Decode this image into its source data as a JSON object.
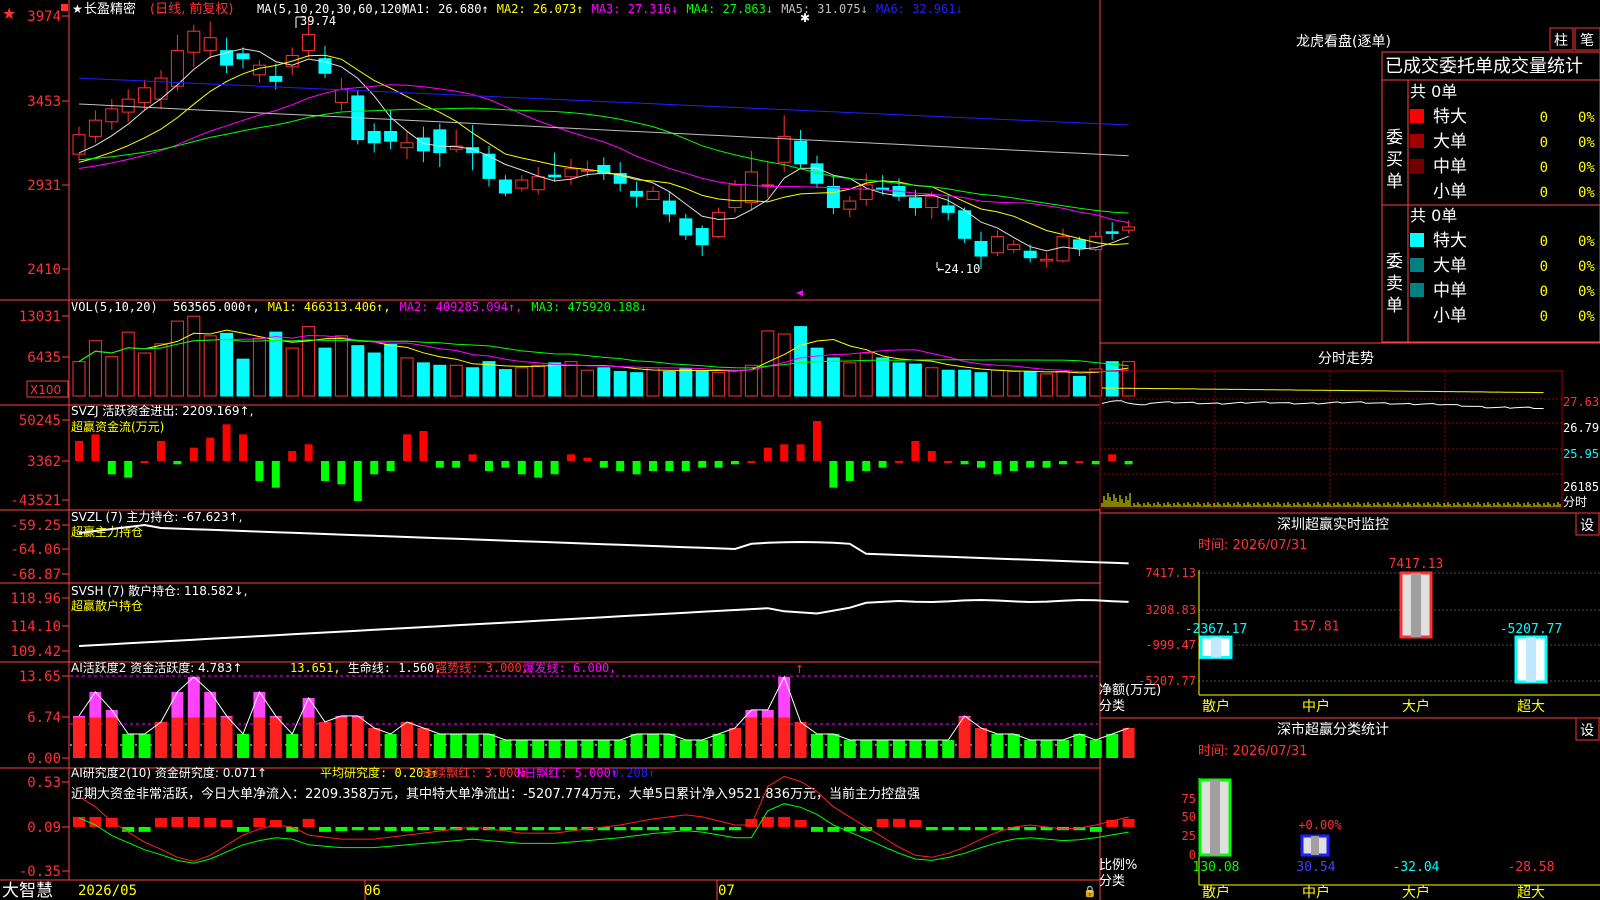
{
  "app": {
    "brand": "大智慧"
  },
  "colors": {
    "up": "#ff3232",
    "down": "#00ffff",
    "grid": "#a00000",
    "axis": "#ff4040",
    "white": "#e0e0e0",
    "yellow": "#ffff00",
    "magenta": "#ff00ff",
    "green": "#00ff00",
    "blue": "#2020ff",
    "gray": "#c0c0c0"
  },
  "main_chart": {
    "name": "长盈精密",
    "period_label": "(日线, 前复权)",
    "ma_label": "MA(5,10,20,30,60,120)",
    "ma_values": [
      {
        "label": "MA1: 26.680↑",
        "color": "#ffffff"
      },
      {
        "label": "MA2: 26.073↑",
        "color": "#ffff00"
      },
      {
        "label": "MA3: 27.316↓",
        "color": "#ff00ff"
      },
      {
        "label": "MA4: 27.863↓",
        "color": "#00ff00"
      },
      {
        "label": "MA5: 31.075↓",
        "color": "#c0c0c0"
      },
      {
        "label": "MA6: 32.961↓",
        "color": "#2020ff"
      }
    ],
    "y_ticks": [
      "3974",
      "3453",
      "2931",
      "2410"
    ],
    "high_label": "39.74",
    "low_label": "24.10",
    "first_visible_tick": "3974"
  },
  "vol_pane": {
    "label": "VOL(5,10,20)",
    "values": [
      {
        "text": "563565.000↑,",
        "color": "#ffffff"
      },
      {
        "text": "MA1: 466313.406↑,",
        "color": "#ffff00"
      },
      {
        "text": "MA2: 409285.094↑,",
        "color": "#ff00ff"
      },
      {
        "text": "MA3: 475920.188↓",
        "color": "#00ff00"
      }
    ],
    "y_ticks": [
      "13031",
      "6435"
    ],
    "unit": "X100"
  },
  "svzj_pane": {
    "label": "SVZJ  活跃资金进出: 2209.169↑,",
    "sublabel": "超赢资金流(万元)",
    "y_ticks": [
      "50245",
      "3362",
      "-43521"
    ]
  },
  "svzl_pane": {
    "label": "SVZL (7) 主力持仓: -67.623↑,",
    "sublabel": "超赢主力持仓",
    "y_ticks": [
      "-59.25",
      "-64.06",
      "-68.87"
    ]
  },
  "svsh_pane": {
    "label": "SVSH (7) 散户持仓: 118.582↓,",
    "sublabel": "超赢散户持仓",
    "y_ticks": [
      "118.96",
      "114.10",
      "109.42"
    ]
  },
  "ai_active_pane": {
    "label": "AI活跃度2 资金活跃度: 4.783↑",
    "values": [
      {
        "text": "13.651,",
        "color": "#ffff00"
      },
      {
        "text": "生命线: 1.560,",
        "color": "#ffffff"
      },
      {
        "text": "强势线: 3.000,",
        "color": "#ff3232"
      },
      {
        "text": "爆发线: 6.000,",
        "color": "#ff00ff"
      }
    ],
    "y_ticks": [
      "13.65",
      "6.74",
      "0.00"
    ]
  },
  "ai_research_pane": {
    "label": "AI研究度2(10) 资金研究度: 0.071↑",
    "values": [
      {
        "text": "平均研究度: 0.203↑",
        "color": "#ffff00"
      },
      {
        "text": "连续飘红: 3.000↑",
        "color": "#ff3232"
      },
      {
        "text": "N日飘红: 5.000↑",
        "color": "#ff00ff"
      },
      {
        "text": "0.208↑",
        "color": "#2020ff"
      }
    ],
    "message": "近期大资金非常活跃，今日大单净流入：2209.358万元，其中特大单净流出：-5207.774万元，大单5日累计净入9521.836万元，当前主力控盘强",
    "y_ticks": [
      "0.53",
      "0.09",
      "-0.35"
    ]
  },
  "date_axis": {
    "labels": [
      "2026/05",
      "06",
      "07"
    ]
  },
  "right_panel": {
    "lhb": {
      "title": "龙虎看盘(逐单)",
      "tab_zhu": "柱",
      "tab_bi": "笔",
      "stats_title": "已成交委托单成交量统计",
      "buy_group": "委买单",
      "sell_group": "委卖单",
      "buy_total": "共 0单",
      "sell_total": "共 0单",
      "buy_rows": [
        {
          "label": "特大",
          "count": "0",
          "pct": "0%",
          "color": "#ff0000"
        },
        {
          "label": "大单",
          "count": "0",
          "pct": "0%",
          "color": "#a00000"
        },
        {
          "label": "中单",
          "count": "0",
          "pct": "0%",
          "color": "#700000"
        },
        {
          "label": "小单",
          "count": "0",
          "pct": "0%",
          "color": ""
        }
      ],
      "sell_rows": [
        {
          "label": "特大",
          "count": "0",
          "pct": "0%",
          "color": "#00ffff"
        },
        {
          "label": "大单",
          "count": "0",
          "pct": "0%",
          "color": "#008080"
        },
        {
          "label": "中单",
          "count": "0",
          "pct": "0%",
          "color": "#008080"
        },
        {
          "label": "小单",
          "count": "0",
          "pct": "0%",
          "color": ""
        }
      ]
    },
    "intraday": {
      "title": "分时走势",
      "y_ticks": [
        "27.63",
        "26.79",
        "25.95"
      ],
      "vol_tick": "26185",
      "vol_label": "分时"
    },
    "sz_realtime": {
      "title": "深圳超赢实时监控",
      "settings": "设",
      "time": "时间: 2026/07/31",
      "y_ticks": [
        "7417.13",
        "3208.83",
        "-999.47",
        "-5207.77"
      ],
      "y_axis_label": "净额(万元)",
      "x_axis_label": "分类",
      "categories": [
        "散户",
        "中户",
        "大户",
        "超大"
      ],
      "values": [
        -2367.17,
        157.81,
        7417.13,
        -5207.77
      ],
      "value_labels": [
        "-2367.17",
        "157.81",
        "7417.13",
        "-5207.77"
      ]
    },
    "sz_class": {
      "title": "深市超赢分类统计",
      "settings": "设",
      "time": "时间: 2026/07/31",
      "y_ticks": [
        "75",
        "50",
        "25",
        "0"
      ],
      "y_axis_label": "比例%",
      "x_axis_label": "分类",
      "categories": [
        "散户",
        "中户",
        "大户",
        "超大"
      ],
      "value_labels": [
        "130.08",
        "30.54",
        "-32.04",
        "-28.58"
      ],
      "bar_note": "+0.00%"
    }
  }
}
